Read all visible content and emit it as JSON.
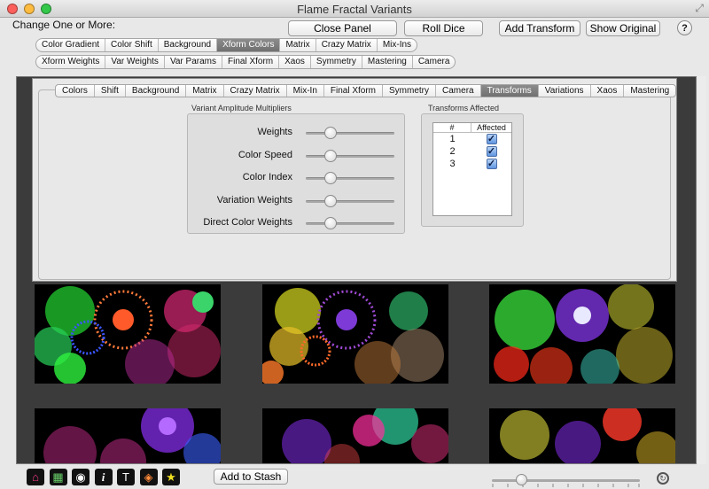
{
  "window": {
    "title": "Flame Fractal Variants"
  },
  "header": {
    "change_label": "Change One or More:"
  },
  "buttons": {
    "close_panel": "Close Panel",
    "roll_dice": "Roll Dice",
    "add_transform": "Add Transform",
    "show_original": "Show Original",
    "help": "?"
  },
  "row1": [
    "Color Gradient",
    "Color Shift",
    "Background",
    "Xform Colors",
    "Matrix",
    "Crazy Matrix",
    "Mix-Ins"
  ],
  "row1_selected": 3,
  "row2": [
    "Xform Weights",
    "Var Weights",
    "Var Params",
    "Final Xform",
    "Xaos",
    "Symmetry",
    "Mastering",
    "Camera"
  ],
  "tabs": [
    "Colors",
    "Shift",
    "Background",
    "Matrix",
    "Crazy Matrix",
    "Mix-In",
    "Final Xform",
    "Symmetry",
    "Camera",
    "Transforms",
    "Variations",
    "Xaos",
    "Mastering"
  ],
  "tabs_selected": 9,
  "amplitude": {
    "title": "Variant Amplitude Multipliers",
    "sliders": [
      {
        "label": "Weights",
        "value": 0.28
      },
      {
        "label": "Color Speed",
        "value": 0.28
      },
      {
        "label": "Color Index",
        "value": 0.28
      },
      {
        "label": "Variation Weights",
        "value": 0.28
      },
      {
        "label": "Direct Color Weights",
        "value": 0.28
      }
    ]
  },
  "transforms": {
    "title": "Transforms Affected",
    "col_num": "#",
    "col_affected": "Affected",
    "rows": [
      {
        "num": "1",
        "checked": true
      },
      {
        "num": "2",
        "checked": true
      },
      {
        "num": "3",
        "checked": true
      }
    ]
  },
  "toolbar": {
    "add_to_stash": "Add to Stash",
    "icons": [
      "home-icon",
      "grid-icon",
      "eye-icon",
      "info-icon",
      "text-icon",
      "palette-icon",
      "star-icon"
    ]
  },
  "zoom": {
    "value": 0.2
  },
  "colors": {
    "selected_segment": "#7d7d7d",
    "checkbox": "#5f95e0"
  }
}
